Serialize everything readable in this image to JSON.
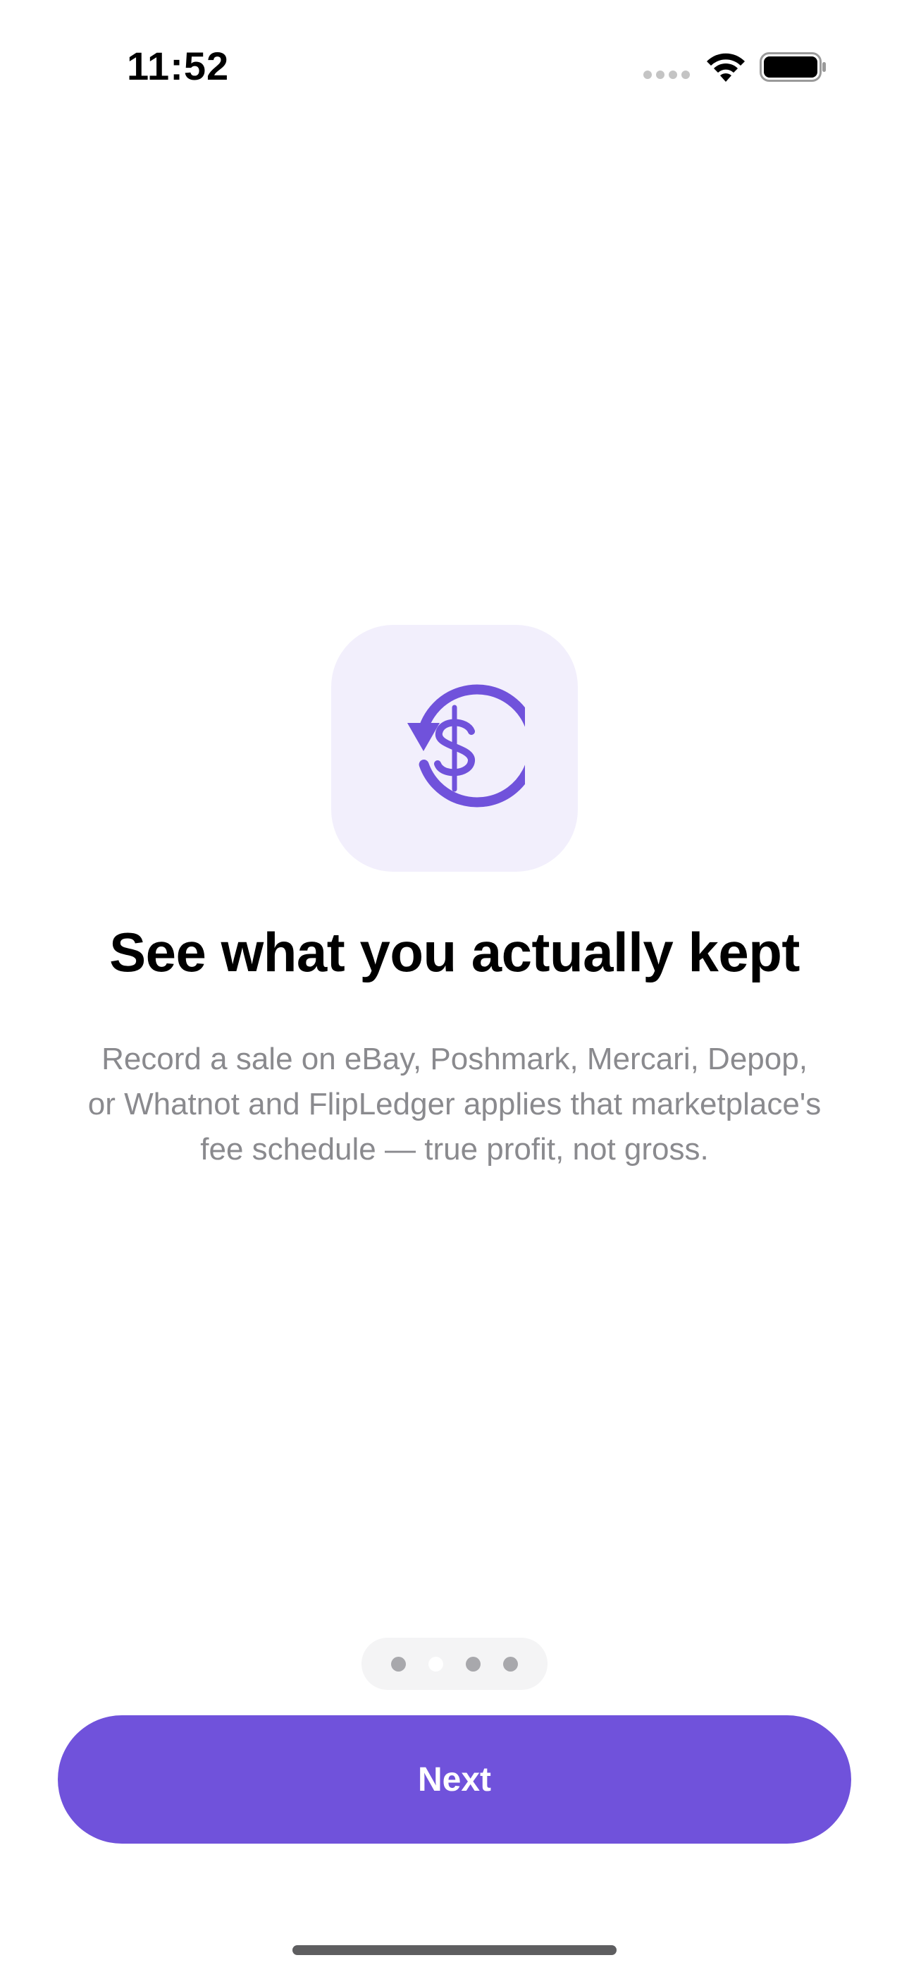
{
  "status_bar": {
    "time": "11:52",
    "icons": [
      "signal-dots-icon",
      "wifi-icon",
      "battery-icon"
    ]
  },
  "onboarding": {
    "icon": "dollar-refresh-icon",
    "title": "See what you actually kept",
    "description": "Record a sale on eBay, Poshmark, Mercari, Depop, or Whatnot and FlipLedger applies that marketplace's fee schedule — true profit, not gross.",
    "page_count": 4,
    "current_page": 2
  },
  "actions": {
    "next_label": "Next"
  },
  "colors": {
    "accent": "#7052db",
    "icon_tile_background": "#f2effc",
    "description_text": "#8a8a8e"
  }
}
